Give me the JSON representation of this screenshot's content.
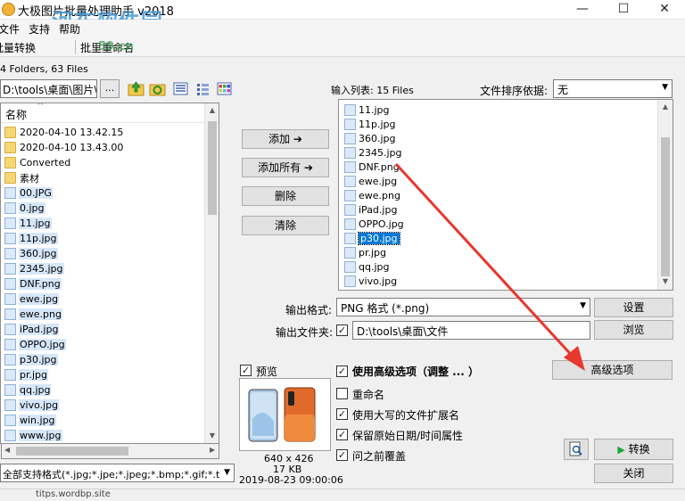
{
  "window": {
    "title": "大极图片批量处理助手  v2018",
    "watermark": "河东软件园",
    "watermark_url": "59.cn",
    "controls": [
      "—",
      "☐",
      "✕"
    ]
  },
  "menu": [
    "文件",
    "支持",
    "帮助"
  ],
  "toolbar": [
    "批量转换",
    "批里重命名"
  ],
  "left": {
    "folder_info": "4 Folders, 63 Files",
    "path": "D:\\tools\\桌面\\图片\\",
    "browse_label": "...",
    "column_header": "名称",
    "items": [
      {
        "name": "2020-04-10 13.42.15",
        "kind": "folder"
      },
      {
        "name": "2020-04-10 13.43.00",
        "kind": "folder"
      },
      {
        "name": "Converted",
        "kind": "folder"
      },
      {
        "name": "素材",
        "kind": "folder"
      },
      {
        "name": "00.JPG",
        "kind": "image"
      },
      {
        "name": "0.jpg",
        "kind": "image"
      },
      {
        "name": "11.jpg",
        "kind": "image"
      },
      {
        "name": "11p.jpg",
        "kind": "image"
      },
      {
        "name": "360.jpg",
        "kind": "image"
      },
      {
        "name": "2345.jpg",
        "kind": "image"
      },
      {
        "name": "DNF.png",
        "kind": "image"
      },
      {
        "name": "ewe.jpg",
        "kind": "image"
      },
      {
        "name": "ewe.png",
        "kind": "image"
      },
      {
        "name": "iPad.jpg",
        "kind": "image"
      },
      {
        "name": "OPPO.jpg",
        "kind": "image"
      },
      {
        "name": "p30.jpg",
        "kind": "image"
      },
      {
        "name": "pr.jpg",
        "kind": "image"
      },
      {
        "name": "qq.jpg",
        "kind": "image"
      },
      {
        "name": "vivo.jpg",
        "kind": "image"
      },
      {
        "name": "win.jpg",
        "kind": "image"
      },
      {
        "name": "www.jpg",
        "kind": "image"
      }
    ],
    "filter": "全部支持格式(*.jpg;*.jpe;*.jpeg;*.bmp;*.gif;*.t"
  },
  "buttons": {
    "add": "添加 ➔",
    "add_all": "添加所有 ➔",
    "delete": "删除",
    "clear": "清除"
  },
  "input_list": {
    "label": "输入列表: 15 Files",
    "sort_label": "文件排序依据:",
    "sort_value": "无",
    "items": [
      "11.jpg",
      "11p.jpg",
      "360.jpg",
      "2345.jpg",
      "DNF.png",
      "ewe.jpg",
      "ewe.png",
      "iPad.jpg",
      "OPPO.jpg",
      "p30.jpg",
      "pr.jpg",
      "qq.jpg",
      "vivo.jpg"
    ],
    "selected": "p30.jpg"
  },
  "output": {
    "format_label": "输出格式:",
    "format_value": "PNG 格式 (*.png)",
    "settings_button": "设置",
    "folder_label": "输出文件夹:",
    "folder_value": "D:\\tools\\桌面\\文件",
    "browse_button": "浏览"
  },
  "preview": {
    "label": "预览",
    "dimensions": "640 x 426",
    "size": "17 KB",
    "date": "2019-08-23 09:00:06"
  },
  "options": {
    "advanced": "使用高级选项（调整 ... ）",
    "advanced_button": "高级选项",
    "rename": "重命名",
    "uppercase_ext": "使用大写的文件扩展名",
    "keep_date": "保留原始日期/时间属性",
    "overwrite": "问之前覆盖"
  },
  "actions": {
    "convert": "转换",
    "close": "关闭"
  },
  "status": "titps.wordbp.site",
  "colors": {
    "arrow": "#e8372c",
    "selection": "#0078d7",
    "convert_icon": "#1aa53a"
  }
}
